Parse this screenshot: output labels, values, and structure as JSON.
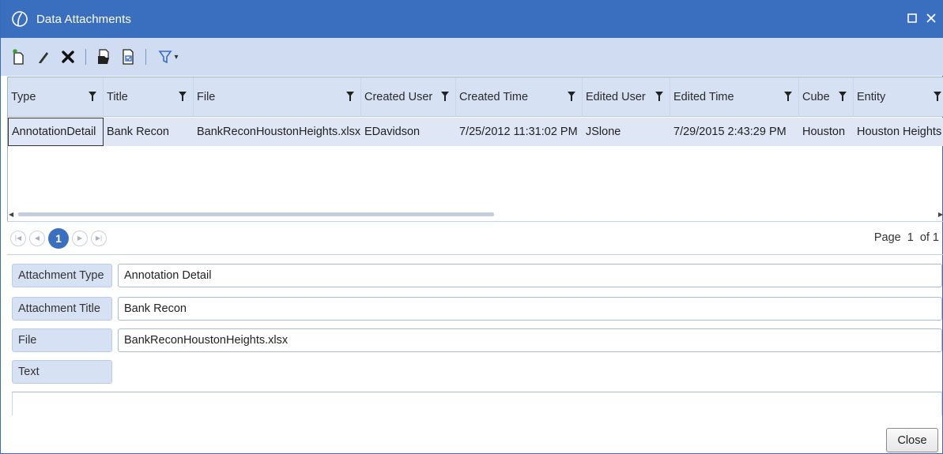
{
  "window": {
    "title": "Data Attachments",
    "logo_icon": "onestream-logo-icon",
    "controls": [
      "maximize-icon",
      "close-icon"
    ]
  },
  "toolbar": {
    "buttons": [
      "new-icon",
      "edit-icon",
      "delete-icon",
      "open-file-icon",
      "save-file-icon",
      "filter-icon"
    ],
    "filter_dropdown_glyph": "▾"
  },
  "grid": {
    "columns": [
      {
        "label": "Type"
      },
      {
        "label": "Title"
      },
      {
        "label": "File"
      },
      {
        "label": "Created User"
      },
      {
        "label": "Created Time"
      },
      {
        "label": "Edited User"
      },
      {
        "label": "Edited Time"
      },
      {
        "label": "Cube"
      },
      {
        "label": "Entity"
      }
    ],
    "rows": [
      {
        "type": "AnnotationDetail",
        "title": "Bank Recon",
        "file": "BankReconHoustonHeights.xlsx",
        "created_user": "EDavidson",
        "created_time": "7/25/2012 11:31:02 PM",
        "edited_user": "JSlone",
        "edited_time": "7/29/2015 2:43:29 PM",
        "cube": "Houston",
        "entity": "Houston Heights"
      }
    ]
  },
  "pager": {
    "current_page": "1",
    "page_label": "Page",
    "page_number": "1",
    "of_label": "of 1"
  },
  "detail": {
    "attachment_type_label": "Attachment Type",
    "attachment_type_value": "Annotation Detail",
    "attachment_title_label": "Attachment Title",
    "attachment_title_value": "Bank Recon",
    "file_label": "File",
    "file_value": "BankReconHoustonHeights.xlsx",
    "text_label": "Text"
  },
  "footer": {
    "close_label": "Close"
  },
  "colors": {
    "titlebar": "#3a6ebf",
    "toolbar": "#cfdcf1",
    "header": "#d6e1f3",
    "selected_row": "#dfe7f6"
  }
}
